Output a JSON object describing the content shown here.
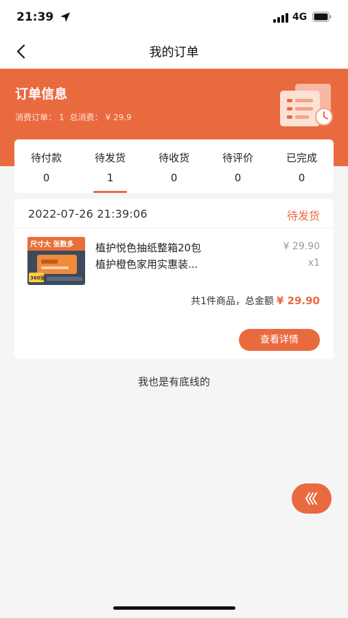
{
  "status_bar": {
    "time": "21:39",
    "network": "4G"
  },
  "nav": {
    "title": "我的订单"
  },
  "header": {
    "title": "订单信息",
    "order_label": "消费订单：",
    "order_count": "1",
    "total_label": "总消费：",
    "total_value": "¥ 29.9"
  },
  "tabs": [
    {
      "label": "待付款",
      "count": "0"
    },
    {
      "label": "待发货",
      "count": "1",
      "active": true
    },
    {
      "label": "待收货",
      "count": "0"
    },
    {
      "label": "待评价",
      "count": "0"
    },
    {
      "label": "已完成",
      "count": "0"
    }
  ],
  "order": {
    "datetime": "2022-07-26 21:39:06",
    "status": "待发货",
    "product": {
      "title_line1": "植护悦色抽纸整箱20包",
      "title_line2": "植护橙色家用实惠装...",
      "price": "¥ 29.90",
      "quantity": "x1",
      "image_text": "尺寸大 张数多",
      "image_badge": "360张"
    },
    "summary_text": "共1件商品，总金额",
    "total_amount": "¥ 29.90",
    "detail_button": "查看详情"
  },
  "footer": {
    "end_text": "我也是有底线的"
  },
  "colors": {
    "accent": "#ea6a40",
    "background": "#f5f5f5",
    "card": "#ffffff"
  },
  "icons": {
    "back": "chevron-left-icon",
    "location": "location-arrow-icon",
    "receipt": "receipt-clock-icon",
    "float": "triple-chevron-left-icon"
  }
}
